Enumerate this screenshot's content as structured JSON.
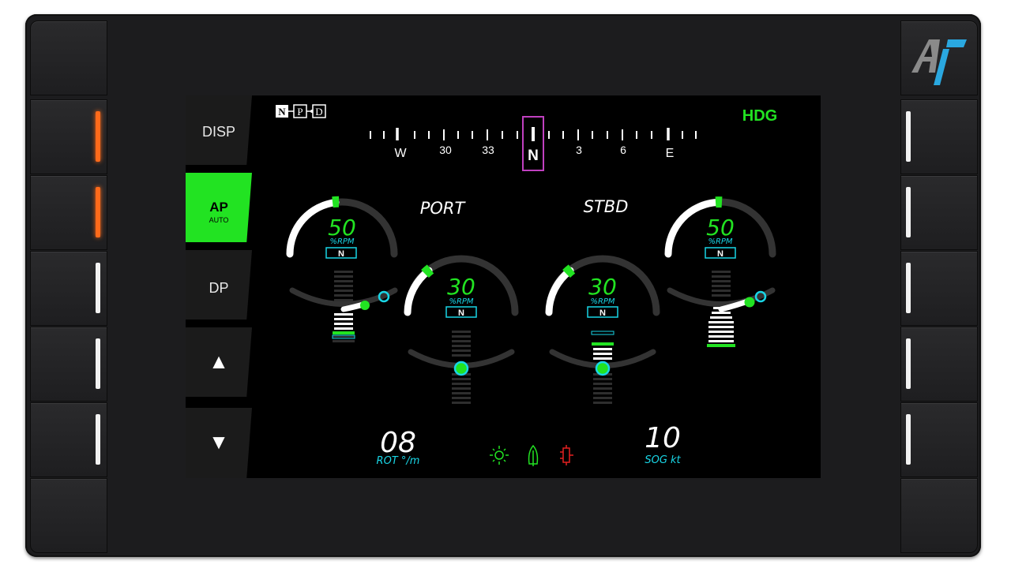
{
  "screen": {
    "npd_letters": [
      "N",
      "P",
      "D"
    ],
    "mode_label": "HDG",
    "compass": {
      "labels": [
        "W",
        "30",
        "33",
        "N",
        "3",
        "6",
        "E"
      ],
      "heading": "N"
    },
    "side_buttons": [
      {
        "label": "DISP",
        "sub": "",
        "active": false
      },
      {
        "label": "AP",
        "sub": "AUTO",
        "active": true
      },
      {
        "label": "DP",
        "sub": "",
        "active": false
      }
    ],
    "up_symbol": "▲",
    "down_symbol": "▼",
    "port_label": "PORT",
    "stbd_label": "STBD",
    "gauges": {
      "port_outer": {
        "value": "50",
        "unit": "%RPM",
        "gear": "N"
      },
      "port_inner": {
        "value": "30",
        "unit": "%RPM",
        "gear": "N"
      },
      "stbd_inner": {
        "value": "30",
        "unit": "%RPM",
        "gear": "N"
      },
      "stbd_outer": {
        "value": "50",
        "unit": "%RPM",
        "gear": "N"
      }
    },
    "rot": {
      "value": "08",
      "unit": "ROT °/m"
    },
    "sog": {
      "value": "10",
      "unit": "SOG kt"
    }
  },
  "colors": {
    "accent_green": "#22e322",
    "cyan": "#19d6e6",
    "magenta": "#c040c0",
    "led_orange": "#ff6a1a",
    "alert_red": "#e52020"
  }
}
